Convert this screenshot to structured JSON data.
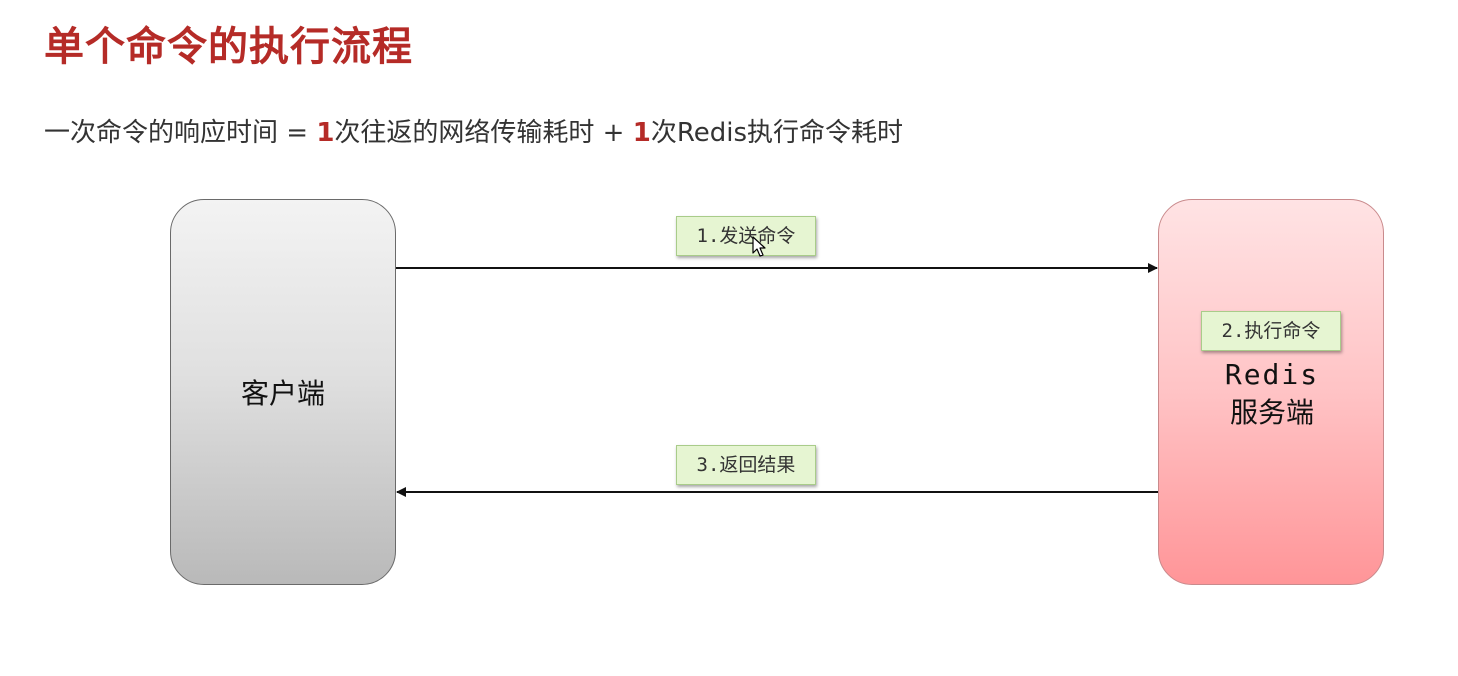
{
  "title": "单个命令的执行流程",
  "formula": {
    "part1": "一次命令的响应时间 = ",
    "num1": "1",
    "part2": "次往返的网络传输耗时 + ",
    "num2": "1",
    "part3": "次Redis执行命令耗时"
  },
  "client": {
    "label": "客户端"
  },
  "server": {
    "label_line1": "Redis",
    "label_line2": "服务端"
  },
  "steps": {
    "send": "1.发送命令",
    "execute": "2.执行命令",
    "return": "3.返回结果"
  },
  "colors": {
    "title": "#b52b27",
    "client_fill": "#d9d9d9",
    "server_fill": "#ffb3b5",
    "tag_fill": "#e6f5d2"
  }
}
